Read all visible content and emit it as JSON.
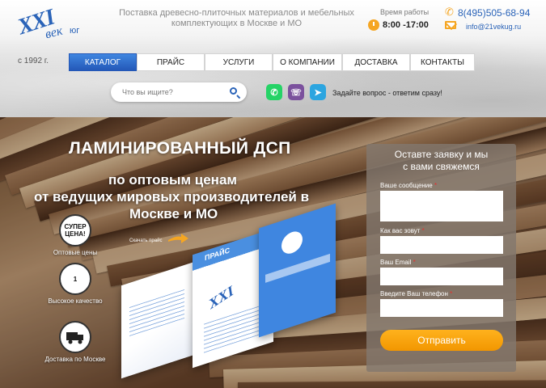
{
  "header": {
    "logo_text": "XXI",
    "logo_sub": "век",
    "logo_suffix": "юг",
    "since": "с 1992 г.",
    "tagline": "Поставка древесно-плиточных материалов и мебельных комплектующих в Москве и МО",
    "hours_label": "Время работы",
    "hours": "8:00 -17:00",
    "phone": "8(495)505-68-94",
    "email": "info@21vekug.ru"
  },
  "nav": {
    "items": [
      {
        "label": "Каталог"
      },
      {
        "label": "Прайс"
      },
      {
        "label": "Услуги"
      },
      {
        "label": "О компании"
      },
      {
        "label": "Доставка"
      },
      {
        "label": "Контакты"
      }
    ]
  },
  "search": {
    "placeholder": "Что вы ищите?"
  },
  "messengers": {
    "ask": "Задайте вопрос - ответим сразу!",
    "icons": [
      "whatsapp-icon",
      "viber-icon",
      "telegram-icon"
    ]
  },
  "hero": {
    "title": "ЛАМИНИРОВАННЫЙ ДСП",
    "subtitle_1": "по оптовым ценам",
    "subtitle_2": "от ведущих мировых производителей в",
    "subtitle_3": "Москве и МО",
    "download_link": "Скачать прайс",
    "brochure_label": "ПРАЙС",
    "features": [
      {
        "badge": "СУПЕР ЦЕНА!",
        "label": "Оптовые цены"
      },
      {
        "badge": "1",
        "label": "Высокое качество"
      },
      {
        "badge": "",
        "label": "Доставка по Москве"
      }
    ]
  },
  "form": {
    "heading_1": "Оставте заявку и мы",
    "heading_2": "с вами свяжемся",
    "fields": [
      {
        "label": "Ваше сообщение",
        "required": "*"
      },
      {
        "label": "Как вас зовут",
        "required": "*"
      },
      {
        "label": "Ваш Email",
        "required": "*"
      },
      {
        "label": "Введите Ваш телефон",
        "required": "*"
      }
    ],
    "submit": "Отправить"
  },
  "colors": {
    "brand_blue": "#2a63b8",
    "accent_orange": "#f5a623"
  }
}
